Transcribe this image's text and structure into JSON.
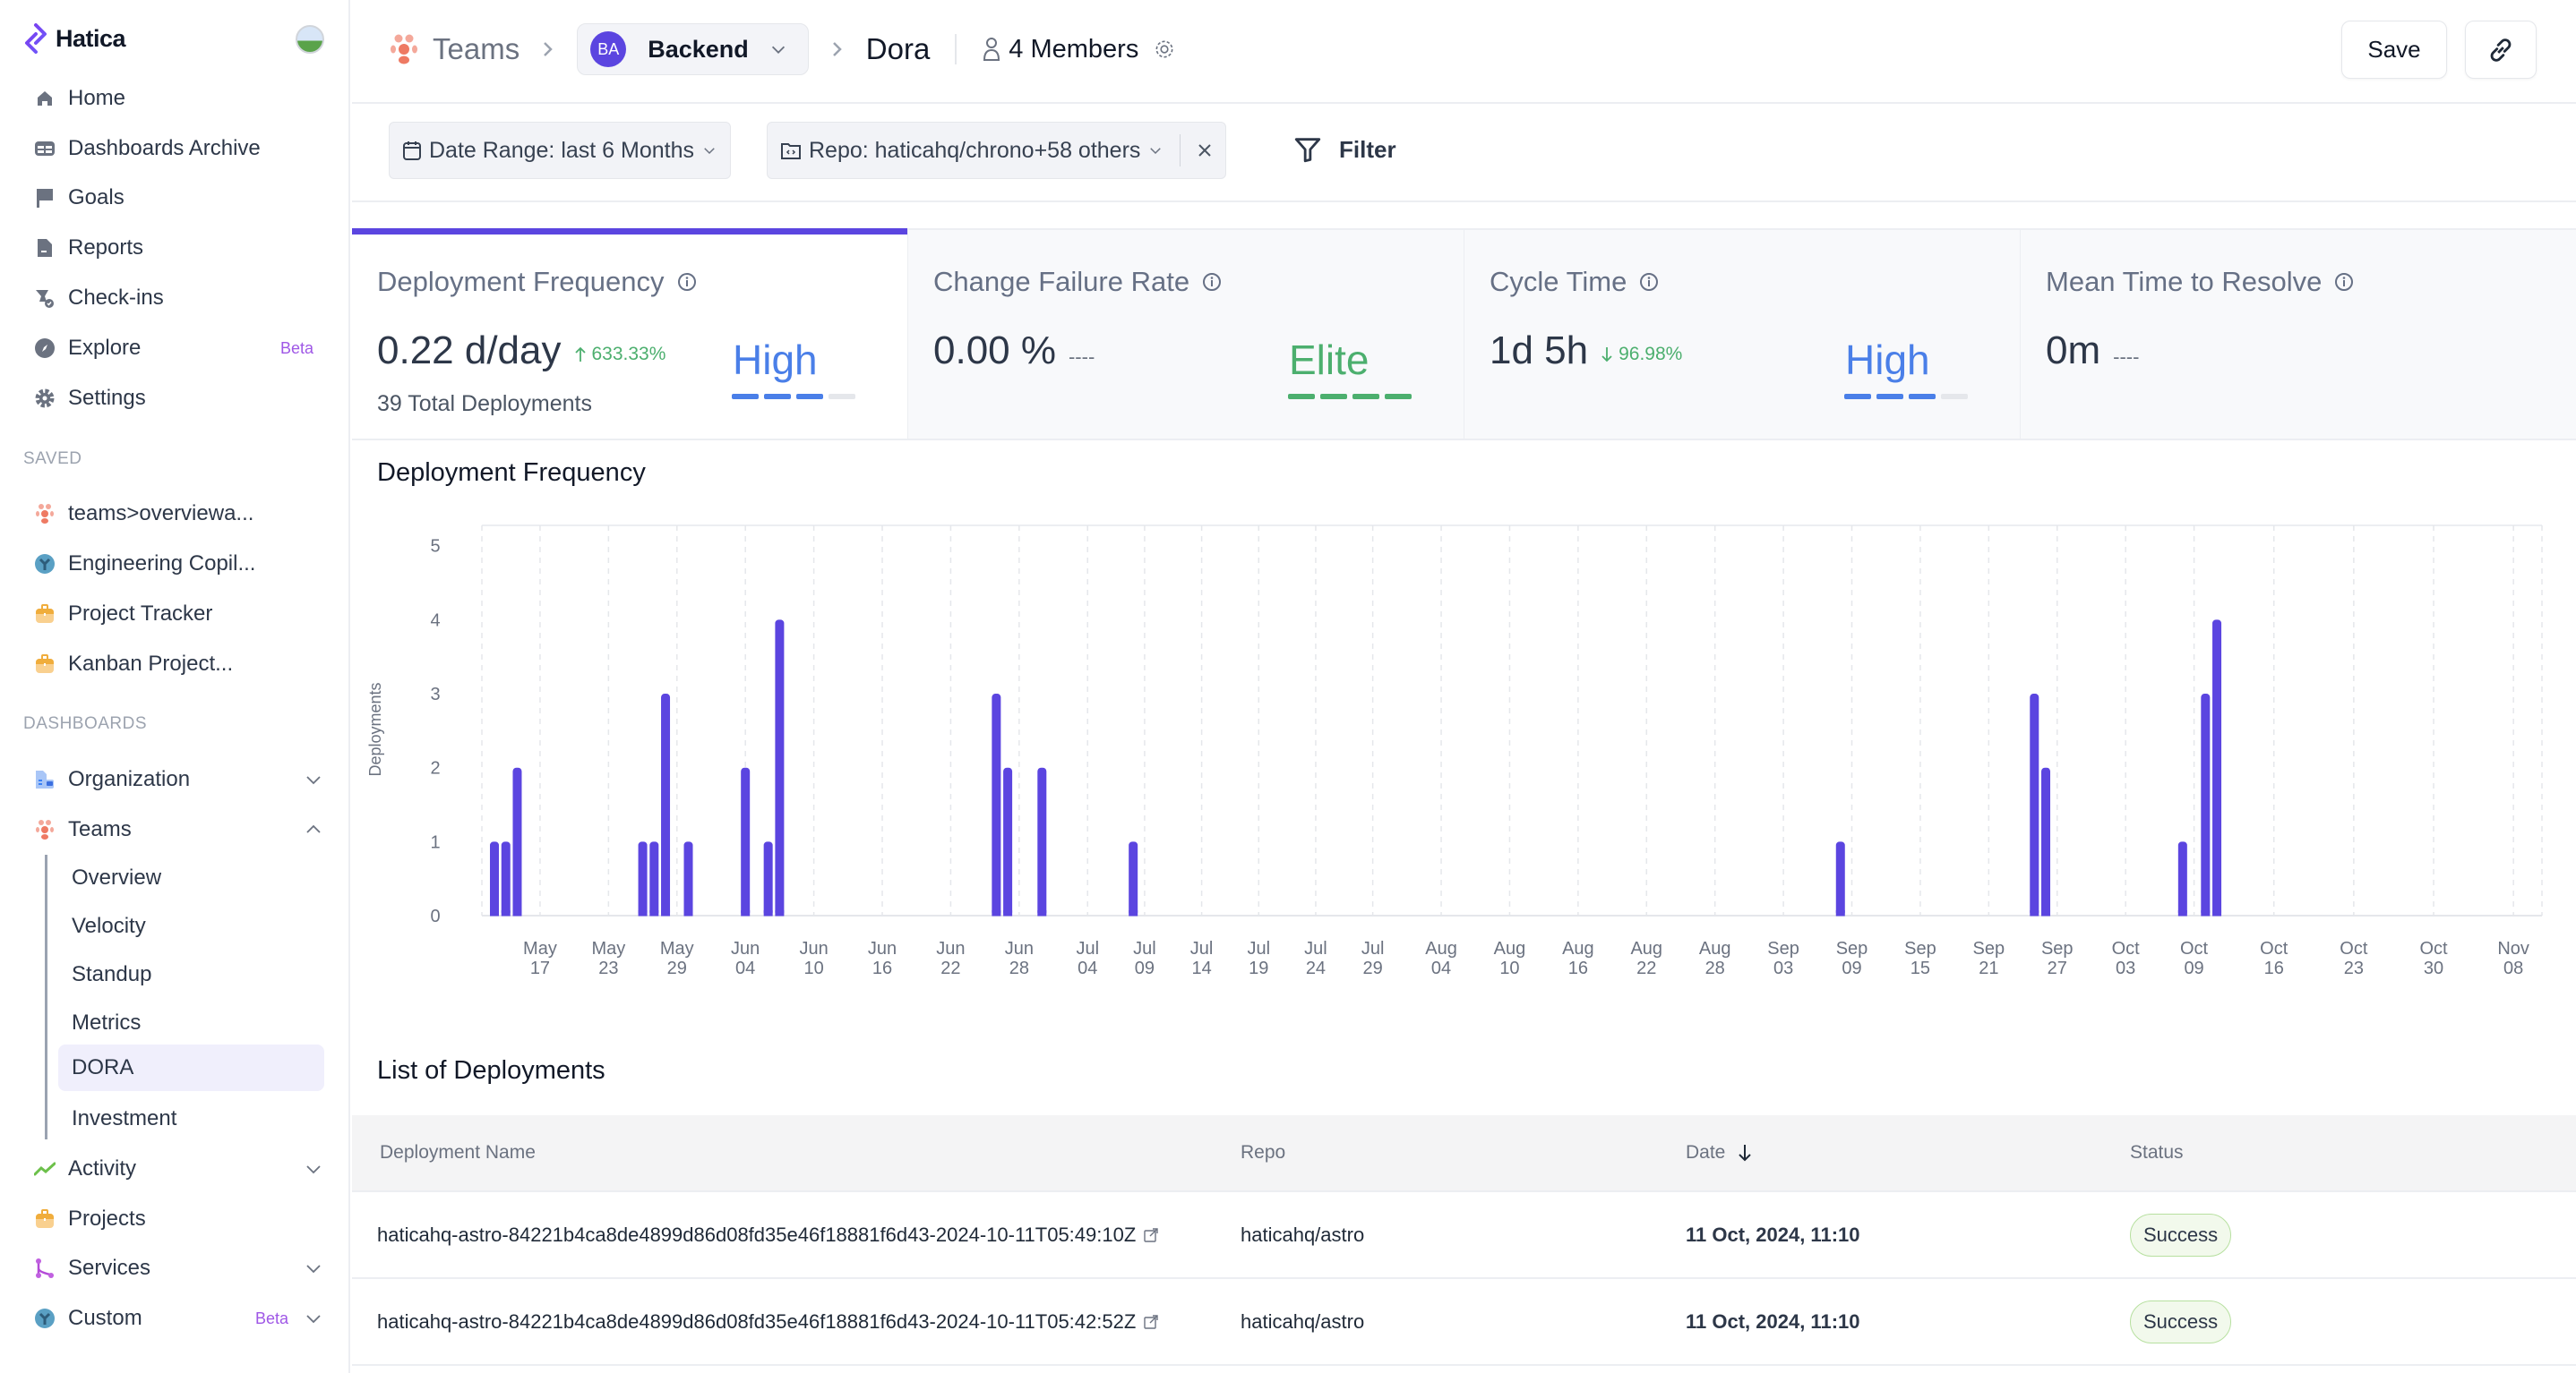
{
  "app": {
    "name": "Hatica"
  },
  "sidebar": {
    "nav": [
      {
        "label": "Home",
        "icon": "home-icon"
      },
      {
        "label": "Dashboards Archive",
        "icon": "dashboard-icon"
      },
      {
        "label": "Goals",
        "icon": "flag-icon"
      },
      {
        "label": "Reports",
        "icon": "document-icon"
      },
      {
        "label": "Check-ins",
        "icon": "checkin-icon"
      },
      {
        "label": "Explore",
        "icon": "compass-icon",
        "badge": "Beta"
      },
      {
        "label": "Settings",
        "icon": "gear-icon"
      }
    ],
    "saved_label": "SAVED",
    "saved": [
      {
        "label": "teams>overviewa...",
        "icon": "teams-icon"
      },
      {
        "label": "Engineering Copil...",
        "icon": "custom-globe-icon"
      },
      {
        "label": "Project Tracker",
        "icon": "briefcase-icon"
      },
      {
        "label": "Kanban Project...",
        "icon": "briefcase-icon"
      }
    ],
    "dashboards_label": "DASHBOARDS",
    "dashboards": {
      "organization": "Organization",
      "teams": "Teams",
      "teams_sub": [
        "Overview",
        "Velocity",
        "Standup",
        "Metrics",
        "DORA",
        "Investment"
      ],
      "active_sub": "DORA",
      "activity": "Activity",
      "projects": "Projects",
      "services": "Services",
      "custom": "Custom",
      "custom_badge": "Beta"
    }
  },
  "header": {
    "crumb_teams": "Teams",
    "team_initials": "BA",
    "team_name": "Backend",
    "page": "Dora",
    "members": "4 Members",
    "save_label": "Save"
  },
  "filters": {
    "date_range": "Date Range: last 6 Months",
    "repo": "Repo: haticahq/chrono+58 others",
    "filter_label": "Filter"
  },
  "metrics": [
    {
      "title": "Deployment Frequency",
      "value": "0.22 d/day",
      "delta": "633.33%",
      "delta_dir": "up",
      "sub": "39 Total Deployments",
      "level": "High",
      "level_color": "#4a7fe8",
      "level_filled": 3,
      "level_total": 4
    },
    {
      "title": "Change Failure Rate",
      "value": "0.00 %",
      "delta": "----",
      "level": "Elite",
      "level_color": "#4caf6e",
      "level_filled": 4,
      "level_total": 4
    },
    {
      "title": "Cycle Time",
      "value": "1d 5h",
      "delta": "96.98%",
      "delta_dir": "down",
      "level": "High",
      "level_color": "#4a7fe8",
      "level_filled": 3,
      "level_total": 4
    },
    {
      "title": "Mean Time to Resolve",
      "value": "0m",
      "delta": "----"
    }
  ],
  "chart_data": {
    "type": "bar",
    "title": "Deployment Frequency",
    "xlabel": "",
    "ylabel": "Deployments",
    "ylim": [
      0,
      5
    ],
    "yticks": [
      0,
      1,
      2,
      3,
      4,
      5
    ],
    "x_range": [
      "2024-05-12",
      "2024-11-08"
    ],
    "grid": true,
    "bar_color": "#5b45e0",
    "points": [
      {
        "date": "2024-05-13",
        "value": 1
      },
      {
        "date": "2024-05-14",
        "value": 1
      },
      {
        "date": "2024-05-15",
        "value": 2
      },
      {
        "date": "2024-05-26",
        "value": 1
      },
      {
        "date": "2024-05-27",
        "value": 1
      },
      {
        "date": "2024-05-28",
        "value": 3
      },
      {
        "date": "2024-05-30",
        "value": 1
      },
      {
        "date": "2024-06-04",
        "value": 2
      },
      {
        "date": "2024-06-06",
        "value": 1
      },
      {
        "date": "2024-06-07",
        "value": 4
      },
      {
        "date": "2024-06-26",
        "value": 3
      },
      {
        "date": "2024-06-27",
        "value": 2
      },
      {
        "date": "2024-06-30",
        "value": 2
      },
      {
        "date": "2024-07-08",
        "value": 1
      },
      {
        "date": "2024-09-08",
        "value": 1
      },
      {
        "date": "2024-09-25",
        "value": 3
      },
      {
        "date": "2024-09-26",
        "value": 2
      },
      {
        "date": "2024-10-08",
        "value": 1
      },
      {
        "date": "2024-10-10",
        "value": 3
      },
      {
        "date": "2024-10-11",
        "value": 4
      }
    ],
    "x_ticks": [
      {
        "date": "2024-05-17",
        "label": [
          "May",
          "17"
        ]
      },
      {
        "date": "2024-05-23",
        "label": [
          "May",
          "23"
        ]
      },
      {
        "date": "2024-05-29",
        "label": [
          "May",
          "29"
        ]
      },
      {
        "date": "2024-06-04",
        "label": [
          "Jun",
          "04"
        ]
      },
      {
        "date": "2024-06-10",
        "label": [
          "Jun",
          "10"
        ]
      },
      {
        "date": "2024-06-16",
        "label": [
          "Jun",
          "16"
        ]
      },
      {
        "date": "2024-06-22",
        "label": [
          "Jun",
          "22"
        ]
      },
      {
        "date": "2024-06-28",
        "label": [
          "Jun",
          "28"
        ]
      },
      {
        "date": "2024-07-04",
        "label": [
          "Jul",
          "04"
        ]
      },
      {
        "date": "2024-07-09",
        "label": [
          "Jul",
          "09"
        ]
      },
      {
        "date": "2024-07-14",
        "label": [
          "Jul",
          "14"
        ]
      },
      {
        "date": "2024-07-19",
        "label": [
          "Jul",
          "19"
        ]
      },
      {
        "date": "2024-07-24",
        "label": [
          "Jul",
          "24"
        ]
      },
      {
        "date": "2024-07-29",
        "label": [
          "Jul",
          "29"
        ]
      },
      {
        "date": "2024-08-04",
        "label": [
          "Aug",
          "04"
        ]
      },
      {
        "date": "2024-08-10",
        "label": [
          "Aug",
          "10"
        ]
      },
      {
        "date": "2024-08-16",
        "label": [
          "Aug",
          "16"
        ]
      },
      {
        "date": "2024-08-22",
        "label": [
          "Aug",
          "22"
        ]
      },
      {
        "date": "2024-08-28",
        "label": [
          "Aug",
          "28"
        ]
      },
      {
        "date": "2024-09-03",
        "label": [
          "Sep",
          "03"
        ]
      },
      {
        "date": "2024-09-09",
        "label": [
          "Sep",
          "09"
        ]
      },
      {
        "date": "2024-09-15",
        "label": [
          "Sep",
          "15"
        ]
      },
      {
        "date": "2024-09-21",
        "label": [
          "Sep",
          "21"
        ]
      },
      {
        "date": "2024-09-27",
        "label": [
          "Sep",
          "27"
        ]
      },
      {
        "date": "2024-10-03",
        "label": [
          "Oct",
          "03"
        ]
      },
      {
        "date": "2024-10-09",
        "label": [
          "Oct",
          "09"
        ]
      },
      {
        "date": "2024-10-16",
        "label": [
          "Oct",
          "16"
        ]
      },
      {
        "date": "2024-10-23",
        "label": [
          "Oct",
          "23"
        ]
      },
      {
        "date": "2024-10-30",
        "label": [
          "Oct",
          "30"
        ]
      },
      {
        "date": "2024-11-06",
        "label": [
          "Nov",
          "08"
        ]
      }
    ]
  },
  "deployments": {
    "title": "List of Deployments",
    "columns": [
      "Deployment Name",
      "Repo",
      "Date",
      "Status"
    ],
    "sort_column": "Date",
    "rows": [
      {
        "name": "haticahq-astro-84221b4ca8de4899d86d08fd35e46f18881f6d43-2024-10-11T05:49:10Z",
        "repo": "haticahq/astro",
        "date": "11 Oct, 2024, 11:10",
        "status": "Success"
      },
      {
        "name": "haticahq-astro-84221b4ca8de4899d86d08fd35e46f18881f6d43-2024-10-11T05:42:52Z",
        "repo": "haticahq/astro",
        "date": "11 Oct, 2024, 11:10",
        "status": "Success"
      }
    ]
  }
}
